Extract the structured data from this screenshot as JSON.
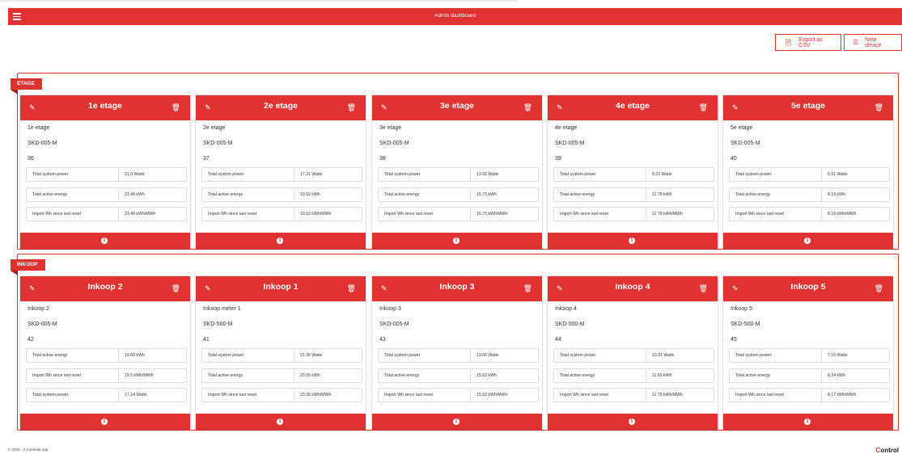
{
  "app": {
    "title": "Admin dashboard"
  },
  "actions": {
    "export_label": "Export as CSV",
    "new_label": "New device"
  },
  "sections": [
    {
      "tag": "ETAGE",
      "cards": [
        {
          "name": "1e etage",
          "desc": "1e etage",
          "type": "SKD-005-M",
          "number": "36",
          "metrics": [
            {
              "label": "Total system power",
              "value": "21.0 Watts"
            },
            {
              "label": "Total active energy",
              "value": "23.49 kWh"
            },
            {
              "label": "Import Wh since last reset",
              "value": "23.49 kWh/MWh"
            }
          ]
        },
        {
          "name": "2e etage",
          "desc": "2e etage",
          "type": "SKD-005-M",
          "number": "37",
          "metrics": [
            {
              "label": "Total system power",
              "value": "17.21 Watts"
            },
            {
              "label": "Total active energy",
              "value": "19.52 kWh"
            },
            {
              "label": "Import Wh since last reset",
              "value": "19.52 kWh/MWh"
            }
          ]
        },
        {
          "name": "3e etage",
          "desc": "3e etage",
          "type": "SKD-005-M",
          "number": "38",
          "metrics": [
            {
              "label": "Total system power",
              "value": "13.65 Watts"
            },
            {
              "label": "Total active energy",
              "value": "15.75 kWh"
            },
            {
              "label": "Import Wh since last reset",
              "value": "15.75 kWh/MWh"
            }
          ]
        },
        {
          "name": "4e etage",
          "desc": "4e etage",
          "type": "SKD-005-M",
          "number": "39",
          "metrics": [
            {
              "label": "Total system power",
              "value": "9.23 Watts"
            },
            {
              "label": "Total active energy",
              "value": "11.78 kWh"
            },
            {
              "label": "Import Wh since last reset",
              "value": "11.78 kWh/MWh"
            }
          ]
        },
        {
          "name": "5e etage",
          "desc": "5e etage",
          "type": "SKD-005-M",
          "number": "40",
          "metrics": [
            {
              "label": "Total system power",
              "value": "6.51 Watts"
            },
            {
              "label": "Total active energy",
              "value": "8.19 kWh"
            },
            {
              "label": "Import Wh since last reset",
              "value": "8.19 kWh/MWh"
            }
          ]
        }
      ]
    },
    {
      "tag": "INKOOP",
      "cards": [
        {
          "name": "Inkoop 2",
          "desc": "Inkoop 2",
          "type": "SKD-005-M",
          "number": "42",
          "metrics": [
            {
              "label": "Total active energy",
              "value": "19.68 kWh"
            },
            {
              "label": "Import Wh since last reset",
              "value": "19.5 kWh/MWh"
            },
            {
              "label": "Total system power",
              "value": "17.14 Watts"
            }
          ]
        },
        {
          "name": "Inkoop 1",
          "desc": "Inkoop meter 1",
          "type": "SKD-500-M",
          "number": "41",
          "metrics": [
            {
              "label": "Total system power",
              "value": "21.35 Watts"
            },
            {
              "label": "Total active energy",
              "value": "23.55 kWh"
            },
            {
              "label": "Import Wh since last reset",
              "value": "23.36 kWh/MWh"
            }
          ]
        },
        {
          "name": "Inkoop 3",
          "desc": "Inkoop 3",
          "type": "SKD-005-M",
          "number": "43",
          "metrics": [
            {
              "label": "Total system power",
              "value": "13.66 Watts"
            },
            {
              "label": "Total active energy",
              "value": "15.63 kWh"
            },
            {
              "label": "Import Wh since last reset",
              "value": "15.63 kWh/MWh"
            }
          ]
        },
        {
          "name": "Inkoop 4",
          "desc": "Inkoop 4",
          "type": "SKD-500-M",
          "number": "44",
          "metrics": [
            {
              "label": "Total system power",
              "value": "10.31 Watts"
            },
            {
              "label": "Total active energy",
              "value": "11.65 kWh"
            },
            {
              "label": "Import Wh since last reset",
              "value": "11.75 kWh/MWh"
            }
          ]
        },
        {
          "name": "Inkoop 5",
          "desc": "Inkoop 5",
          "type": "SKD-500-M",
          "number": "45",
          "metrics": [
            {
              "label": "Total system power",
              "value": "7.19 Watts"
            },
            {
              "label": "Total active energy",
              "value": "8.24 kWh"
            },
            {
              "label": "Import Wh since last reset",
              "value": "8.17 kWh/MWh"
            }
          ]
        }
      ]
    }
  ],
  "footer": {
    "copyright": "© 2015 - A Controlin App",
    "brand_accent": "C",
    "brand_rest": "ontrol"
  },
  "icons": {
    "menu": "hamburger-icon",
    "edit": "edit-icon",
    "delete": "trash-icon",
    "info": "info-icon",
    "export": "file-icon",
    "new": "list-icon"
  },
  "colors": {
    "accent": "#e03331"
  }
}
